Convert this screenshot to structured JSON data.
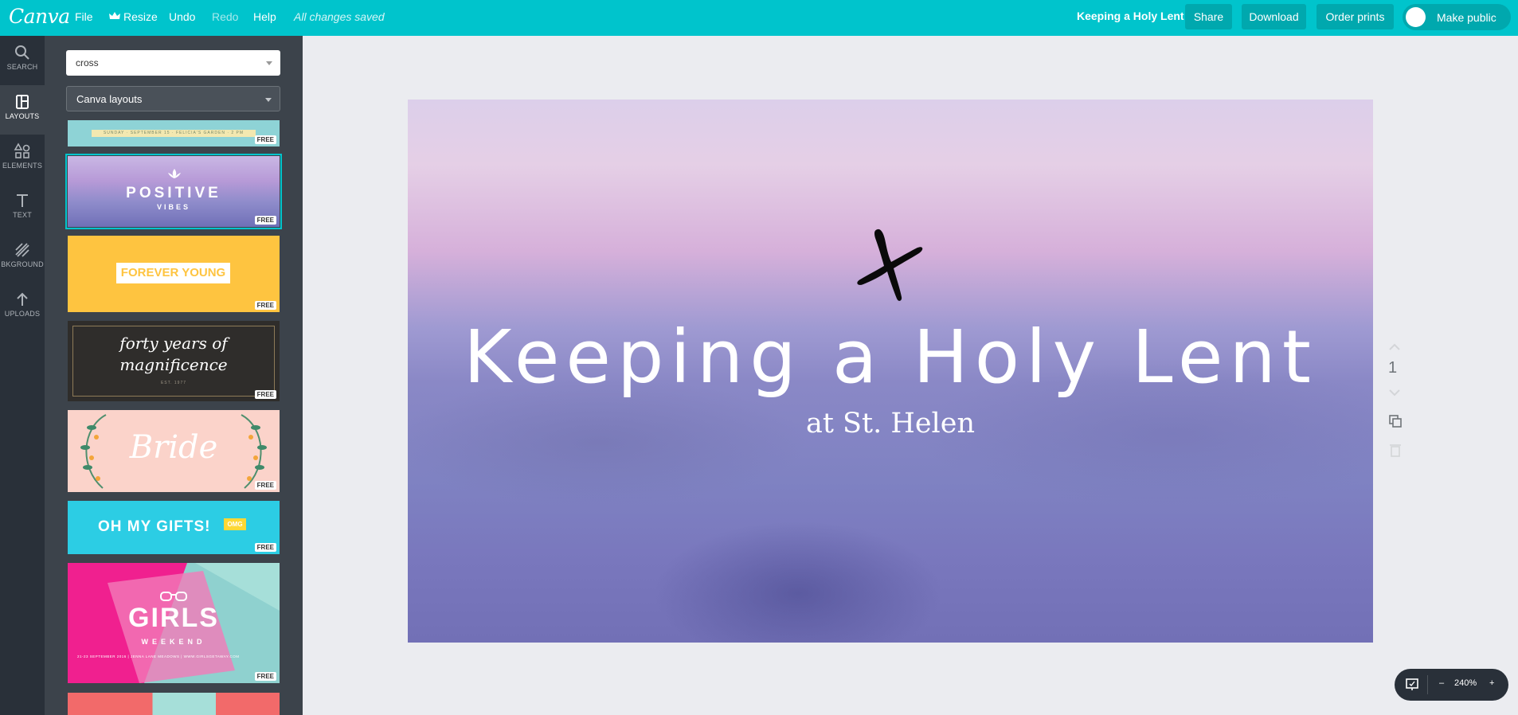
{
  "app": {
    "logo": "Canva"
  },
  "menu": {
    "file": "File",
    "resize": "Resize",
    "undo": "Undo",
    "redo": "Redo",
    "help": "Help",
    "status": "All changes saved"
  },
  "header": {
    "design_title": "Keeping a Holy Lent",
    "share": "Share",
    "download": "Download",
    "order_prints": "Order prints",
    "make_public": "Make public"
  },
  "rail": [
    {
      "label": "SEARCH",
      "icon": "search-icon"
    },
    {
      "label": "LAYOUTS",
      "icon": "layouts-icon",
      "active": true
    },
    {
      "label": "ELEMENTS",
      "icon": "elements-icon"
    },
    {
      "label": "TEXT",
      "icon": "text-icon"
    },
    {
      "label": "BKGROUND",
      "icon": "background-icon"
    },
    {
      "label": "UPLOADS",
      "icon": "upload-icon"
    }
  ],
  "panel": {
    "search_value": "cross",
    "filter_value": "Canva layouts",
    "free_badge": "FREE",
    "thumbs": {
      "t1_text": "SUNDAY · SEPTEMBER 15 · FELICIA'S GARDEN · 2 PM",
      "t2_main": "POSITIVE",
      "t2_sub": "VIBES",
      "t3_main": "FOREVER YOUNG",
      "t4_line1": "forty years of",
      "t4_line2": "magnificence",
      "t4_small": "EST. 1977",
      "t5_main": "Bride",
      "t6_main": "OH MY GIFTS!",
      "t6_tag": "OMG",
      "t7_main": "GIRLS",
      "t7_sub": "WEEKEND",
      "t7_footer": "21-23 SEPTEMBER 2016 | JENNA LANE MEADOWS | WWW.GIRLSGETAWAY.COM"
    }
  },
  "design": {
    "headline": "Keeping a Holy Lent",
    "subline": "at St. Helen",
    "cross_color": "#000000"
  },
  "page_tools": {
    "page_number": "1"
  },
  "zoom": {
    "minus": "–",
    "level": "240%",
    "plus": "+"
  },
  "colors": {
    "brand": "#00c4cc",
    "rail": "#293039",
    "panel": "#3c434b",
    "workspace": "#ebecf0"
  }
}
